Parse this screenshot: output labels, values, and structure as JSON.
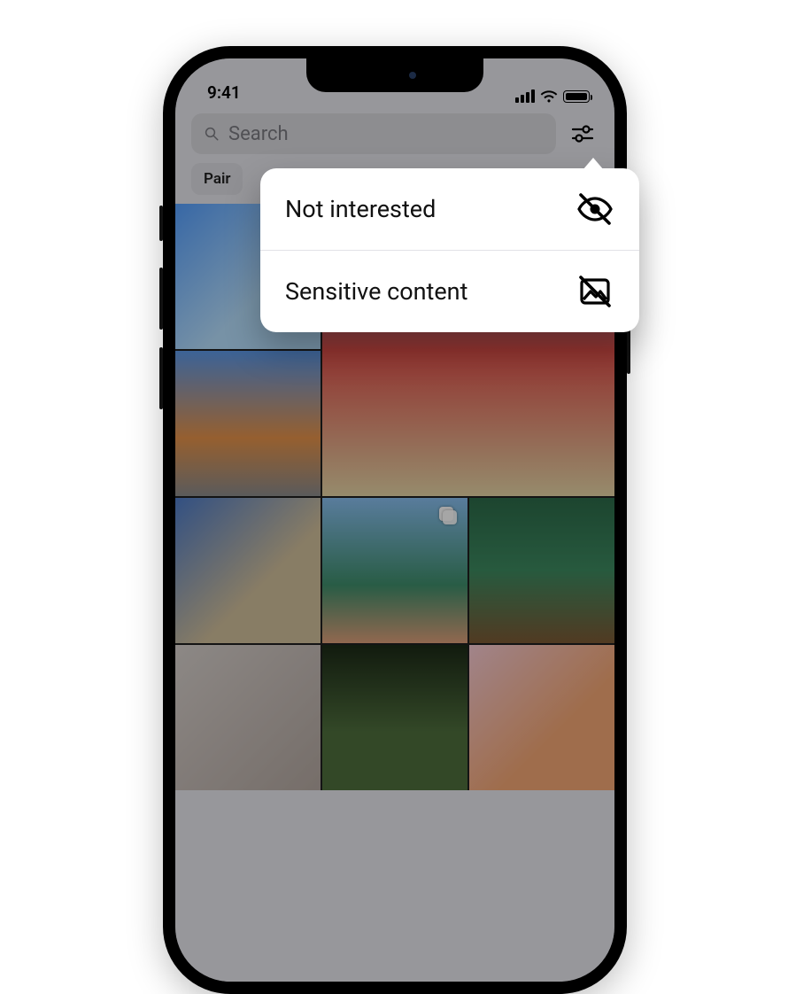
{
  "statusbar": {
    "time": "9:41"
  },
  "toolbar": {
    "search_placeholder": "Search"
  },
  "chips": [
    {
      "label": "Pair"
    }
  ],
  "grid": {
    "tiles": [
      {
        "style": "th-a",
        "big": false
      },
      {
        "style": "th-b",
        "big": true
      },
      {
        "style": "th-c",
        "big": false
      },
      {
        "style": "th-d",
        "big": false
      },
      {
        "style": "th-e",
        "big": false,
        "multi": true
      },
      {
        "style": "th-f",
        "big": false
      },
      {
        "style": "th-g",
        "big": false
      },
      {
        "style": "th-h",
        "big": false
      },
      {
        "style": "th-i",
        "big": false
      }
    ]
  },
  "menu": {
    "items": [
      {
        "label": "Not interested",
        "icon": "eye-off-icon"
      },
      {
        "label": "Sensitive content",
        "icon": "image-off-icon"
      }
    ]
  }
}
